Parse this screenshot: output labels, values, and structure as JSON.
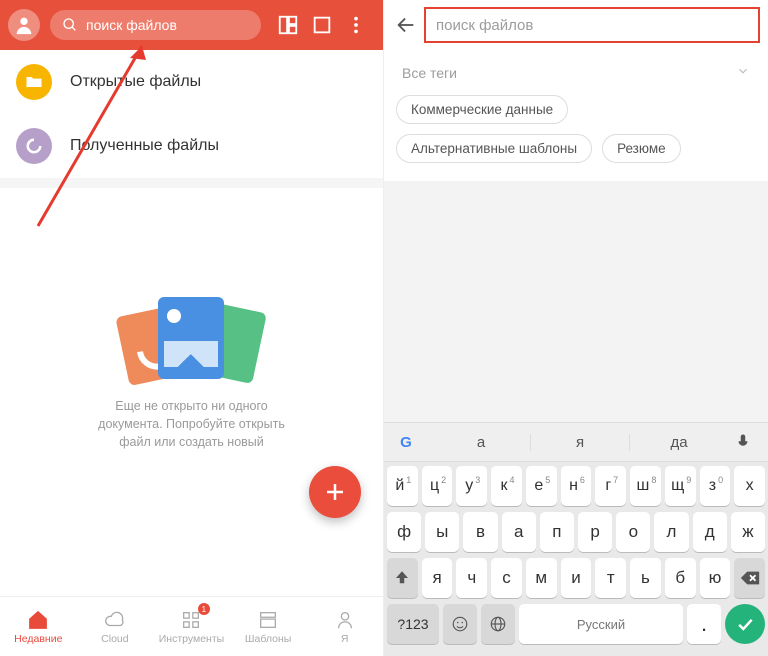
{
  "left": {
    "search_placeholder": "поиск файлов",
    "items": [
      {
        "label": "Открытые файлы"
      },
      {
        "label": "Полученные файлы"
      }
    ],
    "empty_text": "Еще не открыто ни одного документа. Попробуйте открыть файл или создать новый",
    "bottom_nav": [
      {
        "label": "Недавние"
      },
      {
        "label": "Cloud"
      },
      {
        "label": "Инструменты",
        "badge": "1"
      },
      {
        "label": "Шаблоны"
      },
      {
        "label": "Я"
      }
    ]
  },
  "right": {
    "search_placeholder": "поиск файлов",
    "all_tags": "Все теги",
    "chips": [
      "Коммерческие данные",
      "Альтернативные шаблоны",
      "Резюме"
    ],
    "suggestions": [
      "а",
      "я",
      "да"
    ],
    "keyboard": {
      "row1": [
        [
          "й",
          "1"
        ],
        [
          "ц",
          "2"
        ],
        [
          "у",
          "3"
        ],
        [
          "к",
          "4"
        ],
        [
          "е",
          "5"
        ],
        [
          "н",
          "6"
        ],
        [
          "г",
          "7"
        ],
        [
          "ш",
          "8"
        ],
        [
          "щ",
          "9"
        ],
        [
          "з",
          "0"
        ],
        [
          "х",
          ""
        ]
      ],
      "row2": [
        "ф",
        "ы",
        "в",
        "а",
        "п",
        "р",
        "о",
        "л",
        "д",
        "ж"
      ],
      "row3": [
        "я",
        "ч",
        "с",
        "м",
        "и",
        "т",
        "ь",
        "б",
        "ю"
      ],
      "numKey": "?123",
      "space_label": "Русский",
      "dot": "."
    }
  }
}
